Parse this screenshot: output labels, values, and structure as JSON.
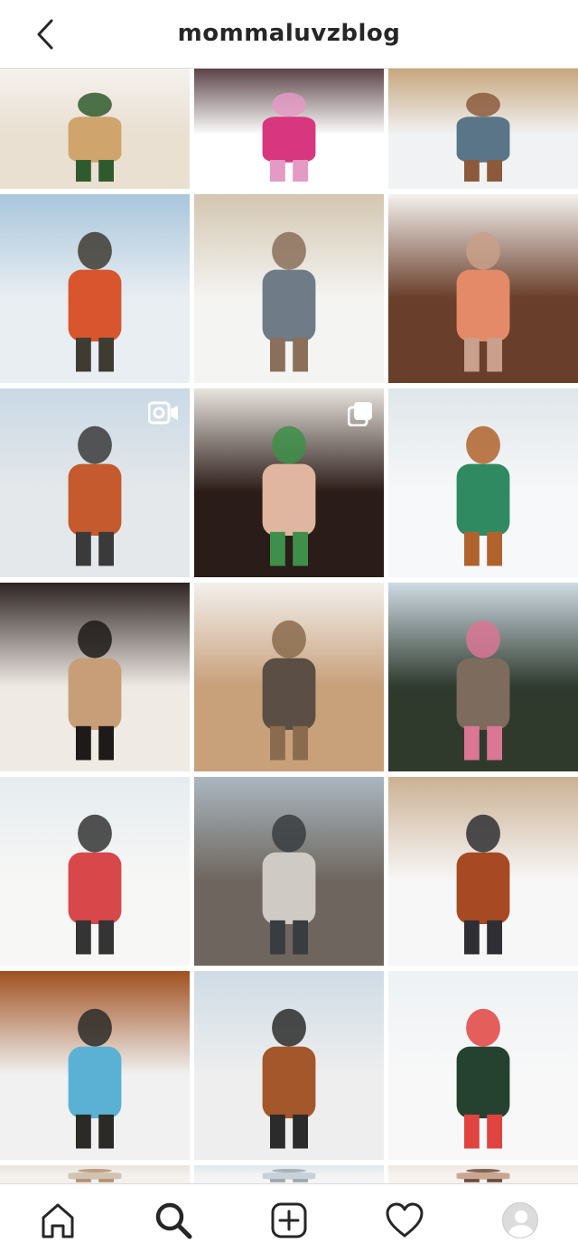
{
  "header": {
    "title": "mommaluvzblog",
    "back_icon": "chevron-left-icon"
  },
  "grid": {
    "posts": [
      {
        "scene": "white-room-mirror-plants",
        "palette": [
          "#f5f1ec",
          "#e9dfd2",
          "#cfa56d",
          "#2f5a2e"
        ]
      },
      {
        "scene": "child-pink-jacket-shovel-snow",
        "palette": [
          "#5b4448",
          "#ffffff",
          "#d8367e",
          "#e39ac4"
        ]
      },
      {
        "scene": "woman-legs-jeans-snow",
        "palette": [
          "#c7a67c",
          "#f1f2f4",
          "#5a7488",
          "#8b5a3c"
        ]
      },
      {
        "scene": "dad-lifting-child-mountains",
        "palette": [
          "#a9c6dc",
          "#e8eef2",
          "#d8552e",
          "#3e3b33"
        ]
      },
      {
        "scene": "mom-daughters-winter-field",
        "palette": [
          "#d4c6b0",
          "#f4f4f2",
          "#6f7c88",
          "#8a6f5a"
        ]
      },
      {
        "scene": "woman-selfie-orange-sweater",
        "palette": [
          "#f4f1ee",
          "#6a3f2b",
          "#e58a68",
          "#c9a08b"
        ]
      },
      {
        "scene": "woman-sitting-mountain-view",
        "palette": [
          "#c9d9e6",
          "#e5e8ea",
          "#c45a2e",
          "#3a3a3a"
        ],
        "badge": "video-icon"
      },
      {
        "scene": "woman-applying-serum",
        "palette": [
          "#e9e4de",
          "#2b1c18",
          "#e0b6a0",
          "#3e8f4a"
        ],
        "badge": "carousel-icon"
      },
      {
        "scene": "woman-on-green-bridge-snow",
        "palette": [
          "#dfe6ea",
          "#f7f8f9",
          "#2f8a61",
          "#b0632d"
        ]
      },
      {
        "scene": "woman-restaurant-booth",
        "palette": [
          "#2e2523",
          "#efe9e4",
          "#c79e78",
          "#1d1a19"
        ]
      },
      {
        "scene": "woman-home-decor-wall",
        "palette": [
          "#f3f0ec",
          "#c8a07a",
          "#5b4e44",
          "#8a6b4d"
        ]
      },
      {
        "scene": "family-four-balcony-mountains",
        "palette": [
          "#cfdbe4",
          "#2f3b2e",
          "#7d6b5d",
          "#d97795"
        ]
      },
      {
        "scene": "kids-running-snowy-mountains",
        "palette": [
          "#e6ecf0",
          "#f7f7f5",
          "#d8474a",
          "#343434"
        ]
      },
      {
        "scene": "mom-daughters-leopard-print",
        "palette": [
          "#aab7c0",
          "#6e665e",
          "#cfcac4",
          "#3a3d40"
        ]
      },
      {
        "scene": "woman-sitting-snow-reeds",
        "palette": [
          "#cbb193",
          "#f7f7f7",
          "#a74a24",
          "#2f2f33"
        ]
      },
      {
        "scene": "indoor-pool-wood-ceiling",
        "palette": [
          "#a0501f",
          "#f1f1f1",
          "#5bb1d4",
          "#2c2a27"
        ]
      },
      {
        "scene": "woman-on-log-mountains",
        "palette": [
          "#cfdce6",
          "#eeeeee",
          "#a3572a",
          "#2b2b2b"
        ]
      },
      {
        "scene": "family-sledding-forest",
        "palette": [
          "#eef2f5",
          "#f8f8f8",
          "#25412f",
          "#e0443f"
        ]
      },
      {
        "scene": "partial-row-1",
        "palette": [
          "#e9e3dc",
          "#f4f1ec",
          "#d1c2b2",
          "#b58f72"
        ]
      },
      {
        "scene": "partial-row-2",
        "palette": [
          "#dfe6ec",
          "#f3f3f3",
          "#c8d1d8",
          "#9aa6b0"
        ]
      },
      {
        "scene": "partial-row-3",
        "palette": [
          "#efe8e2",
          "#f6f2ef",
          "#c9a793",
          "#6b4a3a"
        ]
      }
    ]
  },
  "tabbar": {
    "tabs": [
      {
        "name": "home",
        "icon": "home-icon"
      },
      {
        "name": "search",
        "icon": "search-icon",
        "active": true
      },
      {
        "name": "new-post",
        "icon": "add-post-icon"
      },
      {
        "name": "activity",
        "icon": "heart-icon"
      },
      {
        "name": "profile",
        "icon": "avatar-icon"
      }
    ]
  },
  "colors": {
    "text": "#262626",
    "border": "#dbdbdb",
    "background": "#ffffff"
  }
}
